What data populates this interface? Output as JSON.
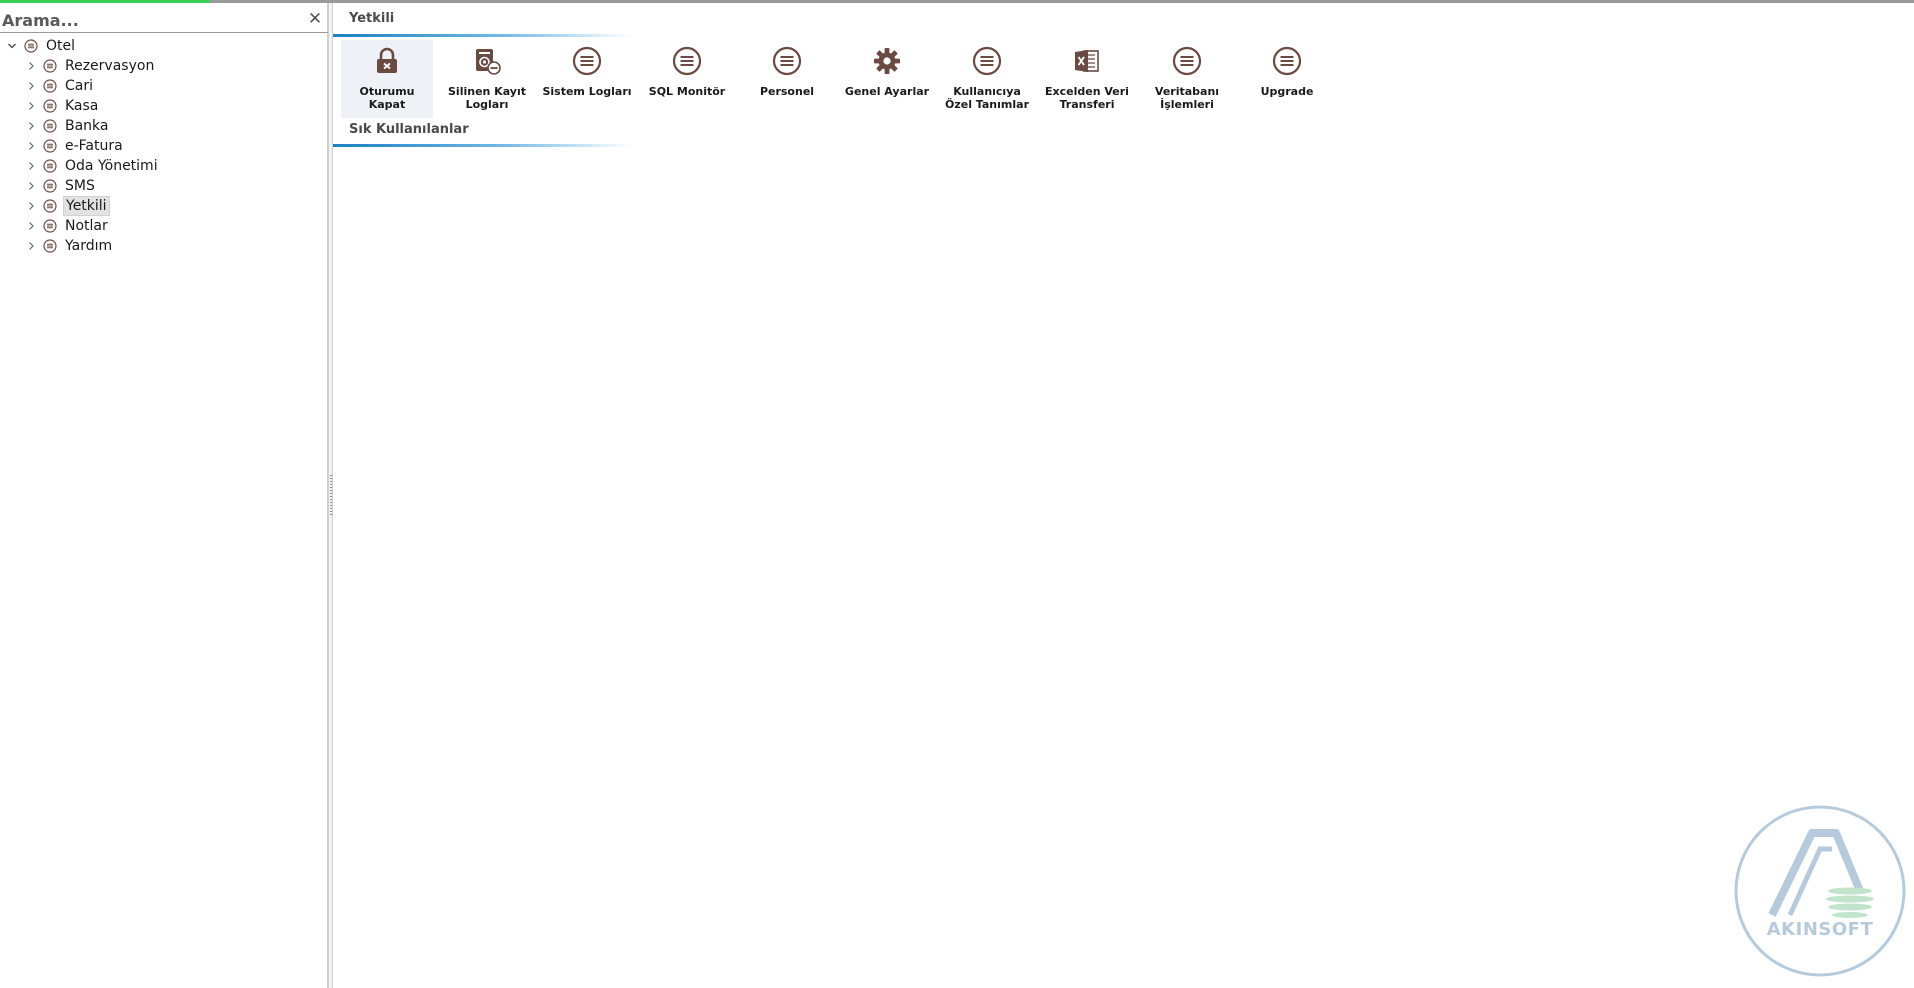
{
  "search": {
    "placeholder": "Arama..."
  },
  "tree": {
    "root": {
      "label": "Otel"
    },
    "children": [
      {
        "label": "Rezervasyon"
      },
      {
        "label": "Cari"
      },
      {
        "label": "Kasa"
      },
      {
        "label": "Banka"
      },
      {
        "label": "e-Fatura"
      },
      {
        "label": "Oda Yönetimi"
      },
      {
        "label": "SMS"
      },
      {
        "label": "Yetkili",
        "selected": true
      },
      {
        "label": "Notlar"
      },
      {
        "label": "Yardım"
      }
    ]
  },
  "groups": {
    "main": {
      "title": "Yetkili"
    },
    "favorites": {
      "title": "Sık Kullanılanlar"
    }
  },
  "tiles": [
    {
      "label": "Oturumu\nKapat",
      "icon": "lock-icon"
    },
    {
      "label": "Silinen Kayıt\nLogları",
      "icon": "deleted-records-icon"
    },
    {
      "label": "Sistem Logları",
      "icon": "menu-circle-icon"
    },
    {
      "label": "SQL Monitör",
      "icon": "menu-circle-icon"
    },
    {
      "label": "Personel",
      "icon": "menu-circle-icon"
    },
    {
      "label": "Genel Ayarlar",
      "icon": "gear-icon"
    },
    {
      "label": "Kullanıcıya\nÖzel Tanımlar",
      "icon": "menu-circle-icon"
    },
    {
      "label": "Excelden Veri\nTransferi",
      "icon": "excel-icon"
    },
    {
      "label": "Veritabanı\nİşlemleri",
      "icon": "menu-circle-icon"
    },
    {
      "label": "Upgrade",
      "icon": "menu-circle-icon"
    }
  ],
  "watermark": {
    "text": "AKINSOFT"
  },
  "colors": {
    "accent": "#1b80c4",
    "icon": "#6b4a42",
    "progress": "#3cd05a"
  }
}
